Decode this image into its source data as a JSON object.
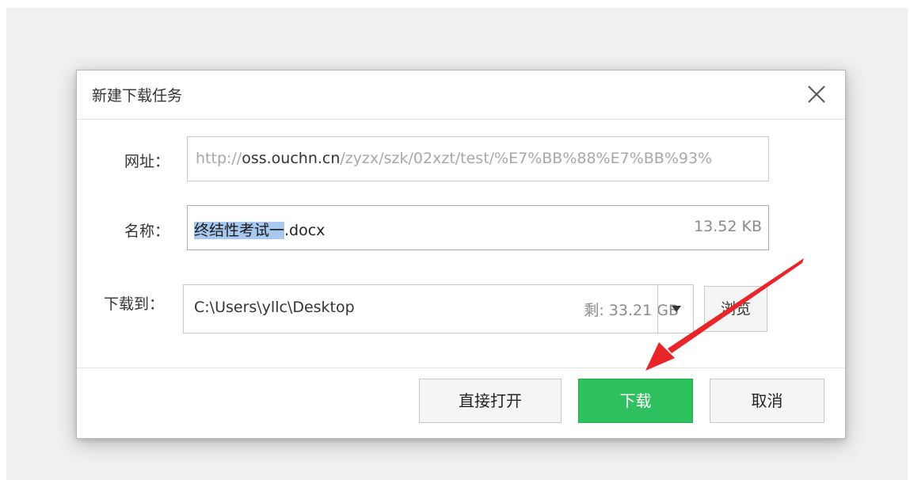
{
  "dialog": {
    "title": "新建下载任务",
    "close_icon": "close-icon"
  },
  "url_row": {
    "label": "网址：",
    "prefix": "http://",
    "host": "oss.ouchn.cn",
    "path": "/zyzx/szk/02xzt/test/%E7%BB%88%E7%BB%93%"
  },
  "name_row": {
    "label": "名称：",
    "name_selected": "终结性考试一",
    "name_rest": ".docx",
    "size": "13.52 KB"
  },
  "save_row": {
    "label": "下载到：",
    "path": "C:\\Users\\yllc\\Desktop",
    "free_space": "剩: 33.21 GB",
    "dropdown_icon": "caret-down-icon",
    "browse_label": "浏览"
  },
  "buttons": {
    "open_direct": "直接打开",
    "download": "下载",
    "cancel": "取消"
  },
  "colors": {
    "download_button": "#2ec05f",
    "selection": "#a8c8f0",
    "annotation_arrow": "#e8262a"
  },
  "annotation": {
    "icon": "red-arrow-icon"
  }
}
